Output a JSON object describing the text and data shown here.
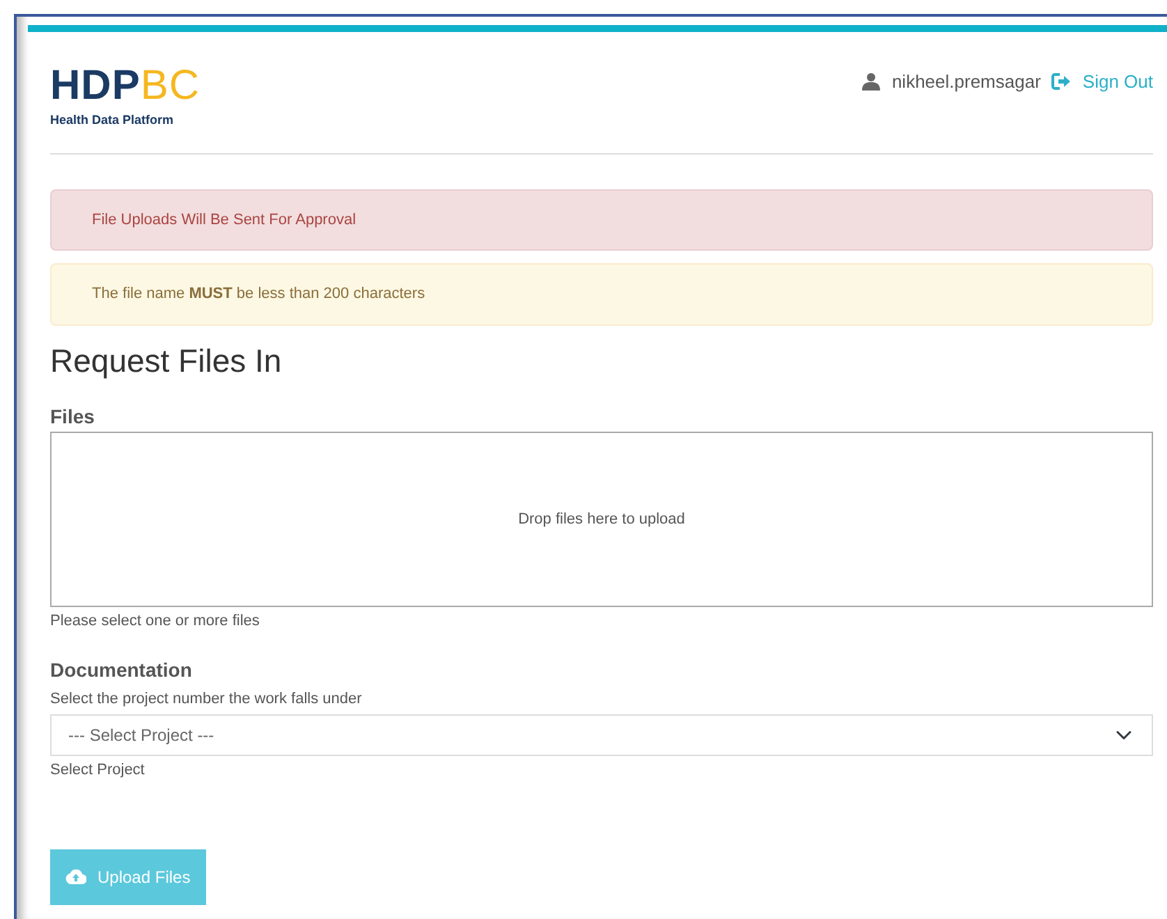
{
  "logo": {
    "primary": "HDP",
    "accent": "BC",
    "subtitle": "Health Data Platform"
  },
  "user": {
    "name": "nikheel.premsagar",
    "sign_out": "Sign Out"
  },
  "alerts": [
    {
      "kind": "danger",
      "text": "File Uploads Will Be Sent For Approval"
    },
    {
      "kind": "warning",
      "text": "The file name **MUST** be less than 200 characters"
    }
  ],
  "title": "Request Files In",
  "files": {
    "label": "Files",
    "dropzone": "Drop files here to upload",
    "help": "Please select one or more files"
  },
  "documentation": {
    "label": "Documentation",
    "hint": "Select the project number the work falls under",
    "select_value": "--- Select Project ---",
    "help": "Select Project"
  },
  "upload_button": {
    "label": "Upload Files",
    "disabled": true
  }
}
